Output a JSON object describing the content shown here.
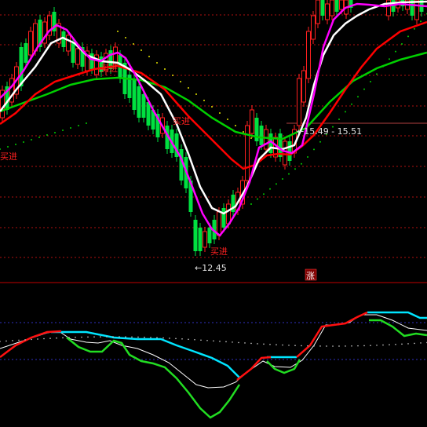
{
  "colors": {
    "background": "#000000",
    "separator": "#c00000",
    "gridline": "#b01010",
    "up_candle": "#ff2020",
    "down_candle": "#00e040",
    "ma_white": "#ffffff",
    "ma_magenta": "#ff00ff",
    "ma_red": "#ff0000",
    "ma_green": "#00d000",
    "dots_green": "#00cc00",
    "dots_yellow": "#e0e000",
    "osc_cyan": "#00e5ff",
    "osc_red": "#ff1010",
    "osc_green": "#22dd22",
    "osc_white": "#ffffff"
  },
  "annotations": {
    "buy_1": "买进",
    "buy_2": "买进",
    "buy_3": "买进",
    "buy_4": "买进",
    "buy_5": "买进",
    "low_price": "12.45",
    "low_arrow": "←",
    "range_price": "15.49 - 15.51",
    "rise_badge": "涨"
  }
}
